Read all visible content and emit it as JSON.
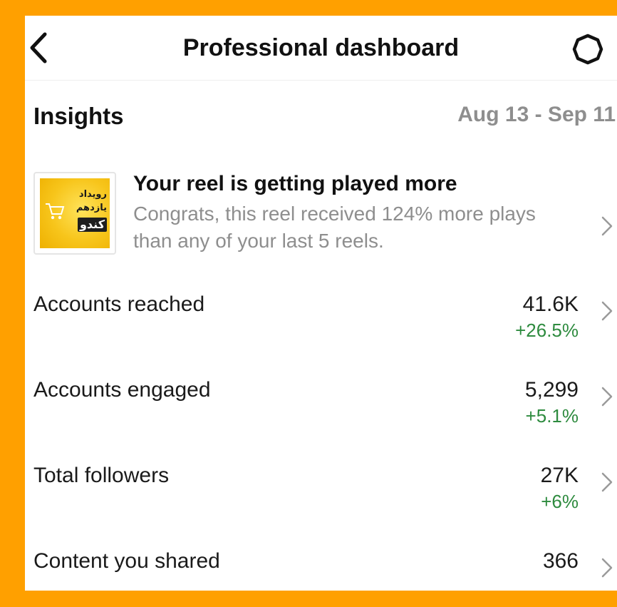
{
  "header": {
    "title": "Professional dashboard",
    "back_icon": "chevron-left-icon",
    "settings_icon": "gear-icon"
  },
  "insights": {
    "title": "Insights",
    "date_range": "Aug 13 - Sep 11"
  },
  "reel_card": {
    "headline": "Your reel is getting played more",
    "description": "Congrats, this reel received 124% more plays than any of your last 5 reels.",
    "thumbnail": {
      "line1": "رویداد",
      "line2": "یازدهم",
      "line3": "کندو"
    }
  },
  "metrics": [
    {
      "label": "Accounts reached",
      "value": "41.6K",
      "change": "+26.5%"
    },
    {
      "label": "Accounts engaged",
      "value": "5,299",
      "change": "+5.1%"
    },
    {
      "label": "Total followers",
      "value": "27K",
      "change": "+6%"
    },
    {
      "label": "Content you shared",
      "value": "366",
      "change": ""
    }
  ],
  "colors": {
    "border": "#ffa000",
    "positive": "#2e8b3f",
    "muted": "#8e8e8e"
  }
}
